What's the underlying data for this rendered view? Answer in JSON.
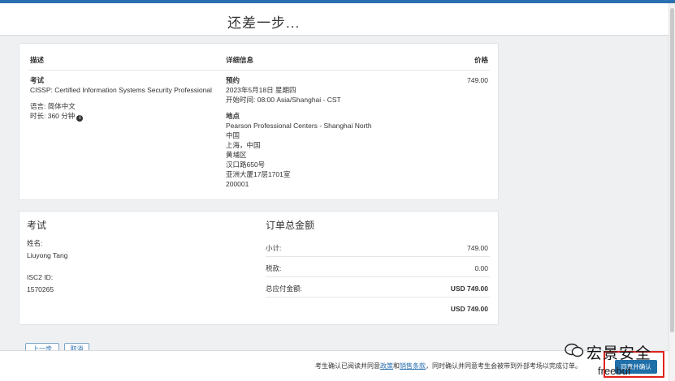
{
  "header": {
    "title": "还差一步..."
  },
  "details": {
    "col_description": "描述",
    "col_details": "详细信息",
    "col_price": "价格",
    "exam_label": "考试",
    "exam_name": "CISSP: Certified Information Systems Security Professional",
    "language": "语言: 简体中文",
    "duration": "时长: 360 分钟",
    "appt_label": "预约",
    "appt_date": "2023年5月18日 星期四",
    "appt_time": "开始时间: 08:00 Asia/Shanghai - CST",
    "location_label": "地点",
    "location_lines": [
      "Pearson Professional Centers - Shanghai North",
      "中国",
      "上海，中国",
      "黄埔区",
      "汉口路650号",
      "亚洲大厦17层1701室",
      "200001"
    ],
    "price": "749.00"
  },
  "summary": {
    "exam_title": "考试",
    "name_label": "姓名:",
    "name_value": "Liuyong Tang",
    "id_label": "ISC2 ID:",
    "id_value": "1570265",
    "total_title": "订单总金额",
    "subtotal_label": "小计:",
    "subtotal_value": "749.00",
    "tax_label": "税款:",
    "tax_value": "0.00",
    "due_label": "总应付金额:",
    "due_value": "USD 749.00",
    "grand_total": "USD 749.00"
  },
  "nav": {
    "previous": "上一步",
    "cancel": "取消"
  },
  "footer": {
    "note_prefix": "考生确认已阅读并同意",
    "policy_link": "政策",
    "and": "和",
    "sales_terms_link": "销售条款",
    "note_suffix": "，同时确认并同意考生会被带到外部考场以完成订单。",
    "confirm_button": "同意并确认"
  },
  "watermark": {
    "brand": "宏景安全",
    "sub": "freebuf"
  }
}
